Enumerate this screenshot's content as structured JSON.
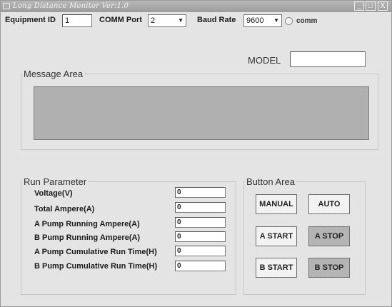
{
  "window": {
    "title": "Long Distance Monitor  Ver:1.0",
    "minimize_glyph": "_",
    "maximize_glyph": "□",
    "close_glyph": "X"
  },
  "toolbar": {
    "equipment_id_label": "Equipment ID",
    "equipment_id_value": "1",
    "comm_port_label": "COMM Port",
    "comm_port_value": "2",
    "baud_rate_label": "Baud Rate",
    "baud_rate_value": "9600",
    "comm_radio_label": "comm"
  },
  "model": {
    "label": "MODEL",
    "value": ""
  },
  "message_area": {
    "title": "Message Area"
  },
  "run_parameter": {
    "title": "Run Parameter",
    "rows": [
      {
        "label": "Voltage(V)",
        "value": "0"
      },
      {
        "label": "Total Ampere(A)",
        "value": "0"
      },
      {
        "label": "A Pump Running Ampere(A)",
        "value": "0"
      },
      {
        "label": "B Pump Running Ampere(A)",
        "value": "0"
      },
      {
        "label": "A Pump Cumulative Run Time(H)",
        "value": "0"
      },
      {
        "label": "B Pump Cumulative Run Time(H)",
        "value": "0"
      }
    ]
  },
  "button_area": {
    "title": "Button Area",
    "manual": "MANUAL",
    "auto": "AUTO",
    "a_start": "A START",
    "a_stop": "A STOP",
    "b_start": "B START",
    "b_stop": "B STOP"
  },
  "colors": {
    "window_bg": "#e4e4e4",
    "titlebar": "#9c9c9c",
    "message_display": "#b0b0b0",
    "stop_button": "#b4b4b4"
  },
  "icons": [
    "app-icon",
    "minimize-icon",
    "maximize-icon",
    "close-icon",
    "chevron-down-icon"
  ]
}
